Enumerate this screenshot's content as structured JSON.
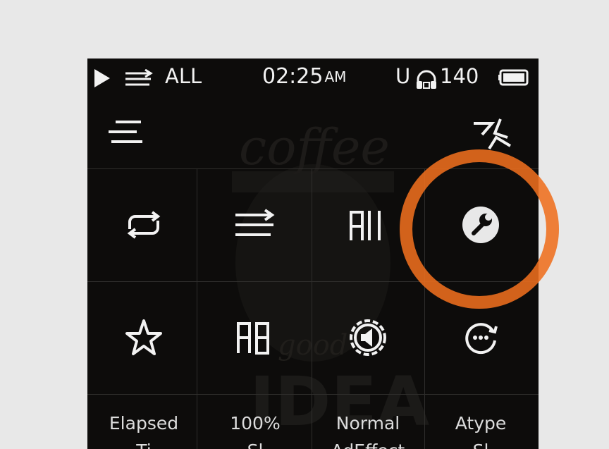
{
  "status_bar": {
    "play_mode_icon": "play-icon",
    "sequence_icon": "sequence-icon",
    "repeat_scope": "ALL",
    "time": "02:25",
    "time_suffix": "AM",
    "usb_label": "U",
    "headphone_icon": "headphone-icon",
    "volume": "140",
    "battery_icon": "battery-icon"
  },
  "top_bar": {
    "menu_icon": "menu-icon",
    "shuffle_icon": "shuffle-icon"
  },
  "grid_row_1": [
    {
      "icon": "repeat-icon"
    },
    {
      "icon": "sequence-icon"
    },
    {
      "icon": "all-icon",
      "text": "All"
    },
    {
      "icon": "wrench-icon"
    }
  ],
  "grid_row_2": [
    {
      "icon": "star-icon"
    },
    {
      "icon": "ab-repeat-icon",
      "text": "AB"
    },
    {
      "icon": "speaker-gear-icon"
    },
    {
      "icon": "dots-rotate-icon"
    }
  ],
  "labels": [
    {
      "line1": "Elapsed",
      "line2": "Ti"
    },
    {
      "line1": "100%",
      "line2": "Sl"
    },
    {
      "line1": "Normal",
      "line2": "AdEffect"
    },
    {
      "line1": "Atype",
      "line2": "Sl"
    }
  ],
  "annotation": {
    "highlight_color": "#ee6e1e"
  },
  "colors": {
    "background": "#e8e8e8",
    "screen": "#0d0c0b",
    "foreground": "#f2f2f2"
  }
}
